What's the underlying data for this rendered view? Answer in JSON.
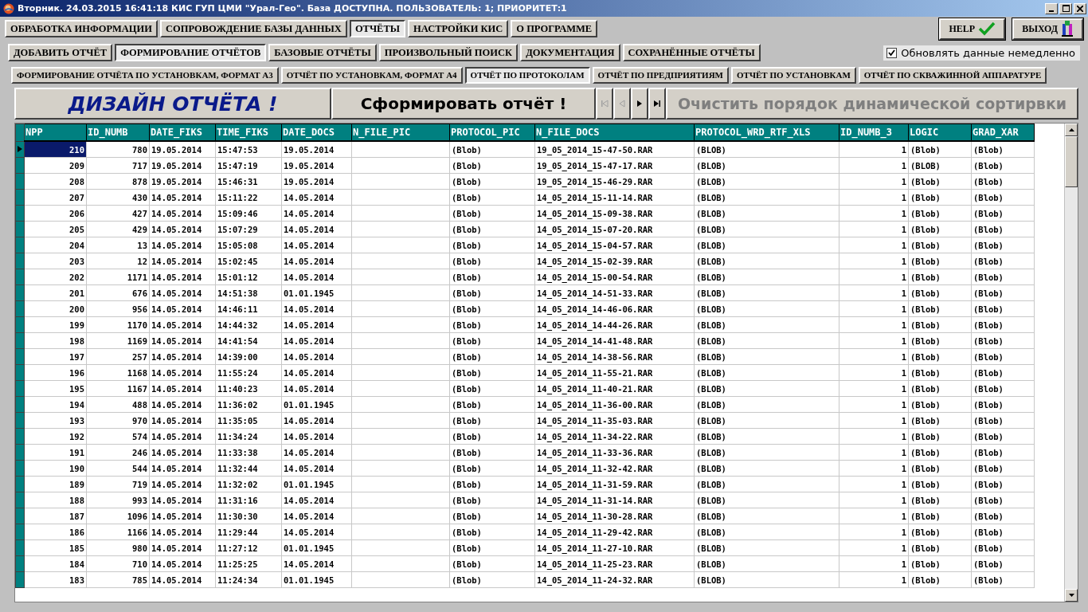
{
  "window": {
    "title": "Вторник. 24.03.2015 16:41:18 КИС ГУП ЦМИ \"Урал-Гео\". База ДОСТУПНА. ПОЛЬЗОВАТЕЛЬ: 1; ПРИОРИТЕТ:1"
  },
  "main_tabs": [
    {
      "label": "ОБРАБОТКА ИНФОРМАЦИИ",
      "selected": false
    },
    {
      "label": "СОПРОВОЖДЕНИЕ БАЗЫ ДАННЫХ",
      "selected": false
    },
    {
      "label": "ОТЧЁТЫ",
      "selected": true
    },
    {
      "label": "НАСТРОЙКИ КИС",
      "selected": false
    },
    {
      "label": "О ПРОГРАММЕ",
      "selected": false
    }
  ],
  "help_button": {
    "label": "HELP"
  },
  "exit_button": {
    "label": "ВЫХОД"
  },
  "sub_tabs": [
    {
      "label": "ДОБАВИТЬ ОТЧЁТ",
      "selected": false
    },
    {
      "label": "ФОРМИРОВАНИЕ ОТЧЁТОВ",
      "selected": true
    },
    {
      "label": "БАЗОВЫЕ ОТЧЁТЫ",
      "selected": false
    },
    {
      "label": "ПРОИЗВОЛЬНЫЙ ПОИСК",
      "selected": false
    },
    {
      "label": "ДОКУМЕНТАЦИЯ",
      "selected": false
    },
    {
      "label": "СОХРАНЁННЫЕ ОТЧЁТЫ",
      "selected": false
    }
  ],
  "refresh_checkbox": {
    "label": "Обновлять данные немедленно",
    "checked": true
  },
  "report_tabs": [
    {
      "label": "ФОРМИРОВАНИЕ ОТЧЁТА ПО УСТАНОВКАМ, ФОРМАТ А3",
      "selected": false
    },
    {
      "label": "ОТЧЁТ ПО УСТАНОВКАМ, ФОРМАТ А4",
      "selected": false
    },
    {
      "label": "ОТЧЁТ ПО ПРОТОКОЛАМ",
      "selected": true
    },
    {
      "label": "ОТЧЁТ ПО ПРЕДПРИЯТИЯМ",
      "selected": false
    },
    {
      "label": "ОТЧЁТ ПО УСТАНОВКАМ",
      "selected": false
    },
    {
      "label": "ОТЧЁТ ПО СКВАЖИННОЙ АППАРАТУРЕ",
      "selected": false
    }
  ],
  "design_button": {
    "label": "ДИЗАЙН ОТЧЁТА !"
  },
  "generate_button": {
    "label": "Сформировать отчёт !"
  },
  "navigator": [
    {
      "kind": "first",
      "disabled": true
    },
    {
      "kind": "prev",
      "disabled": true
    },
    {
      "kind": "next",
      "disabled": false
    },
    {
      "kind": "last",
      "disabled": false
    }
  ],
  "clear_sort_button": {
    "label": "Очистить порядок динамической сортирвки",
    "disabled": true
  },
  "table": {
    "columns": [
      "NPP",
      "ID_NUMB",
      "DATE_FIKS",
      "TIME_FIKS",
      "DATE_DOCS",
      "N_FILE_PIC",
      "PROTOCOL_PIC",
      "N_FILE_DOCS",
      "PROTOCOL_WRD_RTF_XLS",
      "ID_NUMB_3",
      "LOGIC",
      "GRAD_XAR"
    ],
    "rows": [
      {
        "selected": true,
        "cells": [
          "210",
          "780",
          "19.05.2014",
          "15:47:53",
          "19.05.2014",
          null,
          "(Blob)",
          "19_05_2014_15-47-50.RAR",
          "(BLOB)",
          "1",
          "(Blob)",
          "(Blob)"
        ]
      },
      {
        "selected": false,
        "cells": [
          "209",
          "717",
          "19.05.2014",
          "15:47:19",
          "19.05.2014",
          null,
          "(Blob)",
          "19_05_2014_15-47-17.RAR",
          "(BLOB)",
          "1",
          "(BLOB)",
          "(Blob)"
        ]
      },
      {
        "selected": false,
        "cells": [
          "208",
          "878",
          "19.05.2014",
          "15:46:31",
          "19.05.2014",
          null,
          "(Blob)",
          "19_05_2014_15-46-29.RAR",
          "(BLOB)",
          "1",
          "(Blob)",
          "(Blob)"
        ]
      },
      {
        "selected": false,
        "cells": [
          "207",
          "430",
          "14.05.2014",
          "15:11:22",
          "14.05.2014",
          null,
          "(Blob)",
          "14_05_2014_15-11-14.RAR",
          "(BLOB)",
          "1",
          "(Blob)",
          "(Blob)"
        ]
      },
      {
        "selected": false,
        "cells": [
          "206",
          "427",
          "14.05.2014",
          "15:09:46",
          "14.05.2014",
          null,
          "(Blob)",
          "14_05_2014_15-09-38.RAR",
          "(BLOB)",
          "1",
          "(Blob)",
          "(Blob)"
        ]
      },
      {
        "selected": false,
        "cells": [
          "205",
          "429",
          "14.05.2014",
          "15:07:29",
          "14.05.2014",
          null,
          "(Blob)",
          "14_05_2014_15-07-20.RAR",
          "(BLOB)",
          "1",
          "(Blob)",
          "(Blob)"
        ]
      },
      {
        "selected": false,
        "cells": [
          "204",
          "13",
          "14.05.2014",
          "15:05:08",
          "14.05.2014",
          null,
          "(Blob)",
          "14_05_2014_15-04-57.RAR",
          "(BLOB)",
          "1",
          "(Blob)",
          "(Blob)"
        ]
      },
      {
        "selected": false,
        "cells": [
          "203",
          "12",
          "14.05.2014",
          "15:02:45",
          "14.05.2014",
          null,
          "(Blob)",
          "14_05_2014_15-02-39.RAR",
          "(BLOB)",
          "1",
          "(Blob)",
          "(Blob)"
        ]
      },
      {
        "selected": false,
        "cells": [
          "202",
          "1171",
          "14.05.2014",
          "15:01:12",
          "14.05.2014",
          null,
          "(Blob)",
          "14_05_2014_15-00-54.RAR",
          "(BLOB)",
          "1",
          "(Blob)",
          "(Blob)"
        ]
      },
      {
        "selected": false,
        "cells": [
          "201",
          "676",
          "14.05.2014",
          "14:51:38",
          "01.01.1945",
          null,
          "(Blob)",
          "14_05_2014_14-51-33.RAR",
          "(BLOB)",
          "1",
          "(Blob)",
          "(Blob)"
        ]
      },
      {
        "selected": false,
        "cells": [
          "200",
          "956",
          "14.05.2014",
          "14:46:11",
          "14.05.2014",
          null,
          "(Blob)",
          "14_05_2014_14-46-06.RAR",
          "(BLOB)",
          "1",
          "(Blob)",
          "(Blob)"
        ]
      },
      {
        "selected": false,
        "cells": [
          "199",
          "1170",
          "14.05.2014",
          "14:44:32",
          "14.05.2014",
          null,
          "(Blob)",
          "14_05_2014_14-44-26.RAR",
          "(BLOB)",
          "1",
          "(Blob)",
          "(Blob)"
        ]
      },
      {
        "selected": false,
        "cells": [
          "198",
          "1169",
          "14.05.2014",
          "14:41:54",
          "14.05.2014",
          null,
          "(Blob)",
          "14_05_2014_14-41-48.RAR",
          "(BLOB)",
          "1",
          "(Blob)",
          "(Blob)"
        ]
      },
      {
        "selected": false,
        "cells": [
          "197",
          "257",
          "14.05.2014",
          "14:39:00",
          "14.05.2014",
          null,
          "(Blob)",
          "14_05_2014_14-38-56.RAR",
          "(BLOB)",
          "1",
          "(Blob)",
          "(Blob)"
        ]
      },
      {
        "selected": false,
        "cells": [
          "196",
          "1168",
          "14.05.2014",
          "11:55:24",
          "14.05.2014",
          null,
          "(Blob)",
          "14_05_2014_11-55-21.RAR",
          "(BLOB)",
          "1",
          "(Blob)",
          "(Blob)"
        ]
      },
      {
        "selected": false,
        "cells": [
          "195",
          "1167",
          "14.05.2014",
          "11:40:23",
          "14.05.2014",
          null,
          "(Blob)",
          "14_05_2014_11-40-21.RAR",
          "(BLOB)",
          "1",
          "(Blob)",
          "(Blob)"
        ]
      },
      {
        "selected": false,
        "cells": [
          "194",
          "488",
          "14.05.2014",
          "11:36:02",
          "01.01.1945",
          null,
          "(Blob)",
          "14_05_2014_11-36-00.RAR",
          "(BLOB)",
          "1",
          "(Blob)",
          "(Blob)"
        ]
      },
      {
        "selected": false,
        "cells": [
          "193",
          "970",
          "14.05.2014",
          "11:35:05",
          "14.05.2014",
          null,
          "(Blob)",
          "14_05_2014_11-35-03.RAR",
          "(BLOB)",
          "1",
          "(Blob)",
          "(Blob)"
        ]
      },
      {
        "selected": false,
        "cells": [
          "192",
          "574",
          "14.05.2014",
          "11:34:24",
          "14.05.2014",
          null,
          "(Blob)",
          "14_05_2014_11-34-22.RAR",
          "(BLOB)",
          "1",
          "(Blob)",
          "(Blob)"
        ]
      },
      {
        "selected": false,
        "cells": [
          "191",
          "246",
          "14.05.2014",
          "11:33:38",
          "14.05.2014",
          null,
          "(Blob)",
          "14_05_2014_11-33-36.RAR",
          "(BLOB)",
          "1",
          "(Blob)",
          "(Blob)"
        ]
      },
      {
        "selected": false,
        "cells": [
          "190",
          "544",
          "14.05.2014",
          "11:32:44",
          "14.05.2014",
          null,
          "(Blob)",
          "14_05_2014_11-32-42.RAR",
          "(BLOB)",
          "1",
          "(Blob)",
          "(Blob)"
        ]
      },
      {
        "selected": false,
        "cells": [
          "189",
          "719",
          "14.05.2014",
          "11:32:02",
          "01.01.1945",
          null,
          "(Blob)",
          "14_05_2014_11-31-59.RAR",
          "(BLOB)",
          "1",
          "(Blob)",
          "(Blob)"
        ]
      },
      {
        "selected": false,
        "cells": [
          "188",
          "993",
          "14.05.2014",
          "11:31:16",
          "14.05.2014",
          null,
          "(Blob)",
          "14_05_2014_11-31-14.RAR",
          "(BLOB)",
          "1",
          "(Blob)",
          "(Blob)"
        ]
      },
      {
        "selected": false,
        "cells": [
          "187",
          "1096",
          "14.05.2014",
          "11:30:30",
          "14.05.2014",
          null,
          "(Blob)",
          "14_05_2014_11-30-28.RAR",
          "(BLOB)",
          "1",
          "(Blob)",
          "(Blob)"
        ]
      },
      {
        "selected": false,
        "cells": [
          "186",
          "1166",
          "14.05.2014",
          "11:29:44",
          "14.05.2014",
          null,
          "(Blob)",
          "14_05_2014_11-29-42.RAR",
          "(BLOB)",
          "1",
          "(Blob)",
          "(Blob)"
        ]
      },
      {
        "selected": false,
        "cells": [
          "185",
          "980",
          "14.05.2014",
          "11:27:12",
          "01.01.1945",
          null,
          "(Blob)",
          "14_05_2014_11-27-10.RAR",
          "(BLOB)",
          "1",
          "(Blob)",
          "(Blob)"
        ]
      },
      {
        "selected": false,
        "cells": [
          "184",
          "710",
          "14.05.2014",
          "11:25:25",
          "14.05.2014",
          null,
          "(Blob)",
          "14_05_2014_11-25-23.RAR",
          "(BLOB)",
          "1",
          "(Blob)",
          "(Blob)"
        ]
      },
      {
        "selected": false,
        "cells": [
          "183",
          "785",
          "14.05.2014",
          "11:24:34",
          "01.01.1945",
          null,
          "(Blob)",
          "14_05_2014_11-24-32.RAR",
          "(BLOB)",
          "1",
          "(Blob)",
          "(Blob)"
        ]
      }
    ]
  }
}
